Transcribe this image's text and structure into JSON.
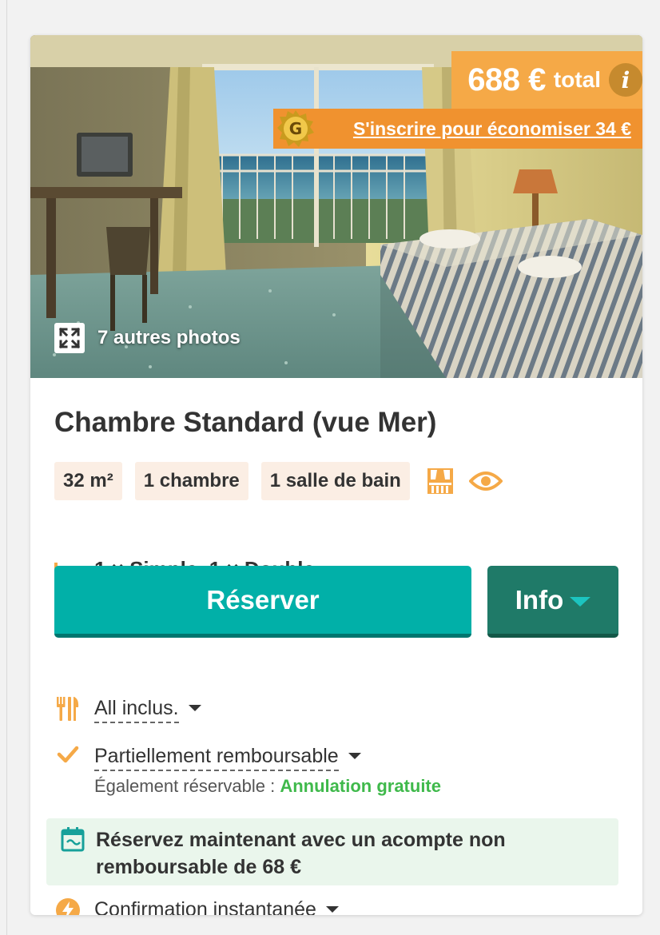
{
  "offer": {
    "price": "688 €",
    "price_label": "total",
    "info_glyph": "i",
    "signup_text": "S'inscrire pour économiser 34 €",
    "genius_letter": "G"
  },
  "photos": {
    "more_label": "7 autres photos"
  },
  "room": {
    "title": "Chambre Standard (vue Mer)",
    "tags": [
      "32 m²",
      "1 chambre",
      "1 salle de bain"
    ],
    "beds": "1 × Simple, 1 × Double"
  },
  "actions": {
    "reserve_label": "Réserver",
    "info_label": "Info"
  },
  "features": {
    "meal": "All inclus.",
    "refund": "Partiellement remboursable",
    "also_bookable_prefix": "Également réservable : ",
    "also_bookable_option": "Annulation gratuite",
    "deposit": "Réservez maintenant avec un acompte non remboursable de 68 €",
    "confirmation": "Confirmation instantanée"
  },
  "colors": {
    "accent_orange": "#f5a947",
    "reserve_teal": "#01b0a8",
    "info_green": "#1f7a68",
    "free_cancel_green": "#3fb94b",
    "icon_orange": "#f5a947"
  }
}
